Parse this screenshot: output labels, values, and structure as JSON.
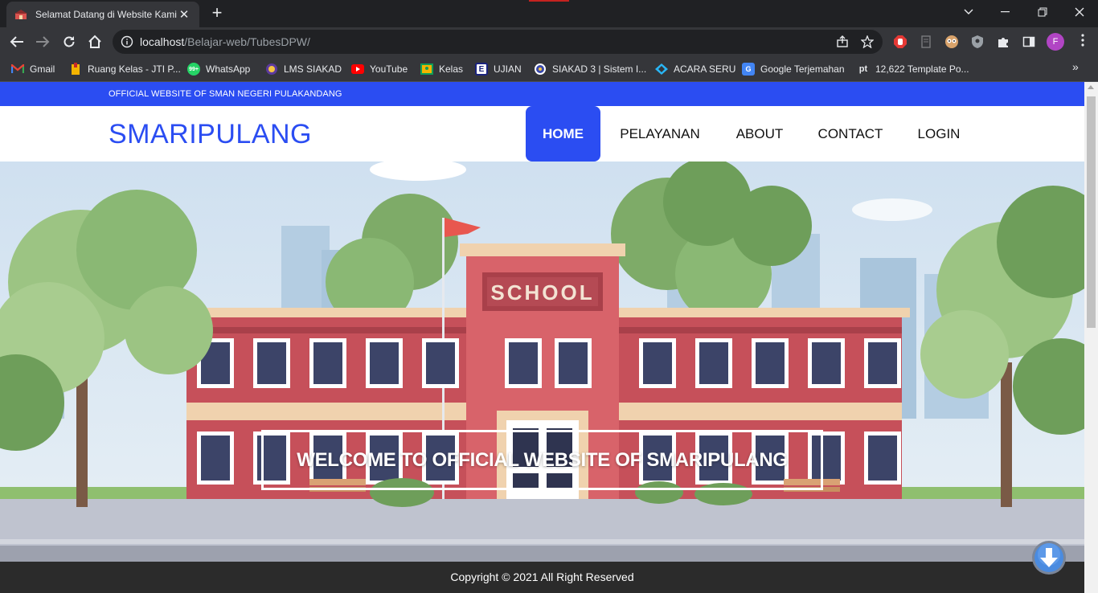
{
  "browser": {
    "tab_title": "Selamat Datang di Website Kami",
    "tab_close": "✕",
    "new_tab": "+",
    "url_host": "localhost",
    "url_path": "/Belajar-web/TubesDPW/",
    "profile_initial": "F",
    "window_controls": {
      "minimize": "—",
      "restore": "❐",
      "close": "✕"
    }
  },
  "bookmarks": [
    {
      "label": "Gmail",
      "icon": "gmail-icon"
    },
    {
      "label": "Ruang Kelas - JTI P...",
      "icon": "ruang-kelas-icon"
    },
    {
      "label": "WhatsApp",
      "icon": "whatsapp-icon"
    },
    {
      "label": "LMS SIAKAD",
      "icon": "lms-icon"
    },
    {
      "label": "YouTube",
      "icon": "youtube-icon"
    },
    {
      "label": "Kelas",
      "icon": "classroom-icon"
    },
    {
      "label": "UJIAN",
      "icon": "ujian-icon"
    },
    {
      "label": "SIAKAD 3 | Sistem I...",
      "icon": "siakad-icon"
    },
    {
      "label": "ACARA SERU",
      "icon": "acara-icon"
    },
    {
      "label": "Google Terjemahan",
      "icon": "translate-icon"
    },
    {
      "label": "12,622 Template Po...",
      "icon": "pt-icon"
    }
  ],
  "bookmarks_more": "»",
  "site": {
    "topbar_text": "OFFICIAL WEBSITE OF SMAN NEGERI PULAKANDANG",
    "brand": "SMARIPULANG",
    "nav": [
      {
        "label": "HOME",
        "active": true
      },
      {
        "label": "PELAYANAN",
        "active": false
      },
      {
        "label": "ABOUT",
        "active": false
      },
      {
        "label": "CONTACT",
        "active": false
      },
      {
        "label": "LOGIN",
        "active": false
      }
    ],
    "hero_school_sign": "SCHOOL",
    "welcome": "WELCOME TO OFFICIAL WEBSITE OF SMARIPULANG",
    "footer": "Copyright © 2021 All Right Reserved"
  },
  "colors": {
    "accent": "#2b4df2",
    "footer_bg": "#2b2b2b",
    "chrome_dark": "#202124",
    "chrome_toolbar": "#35363a"
  }
}
